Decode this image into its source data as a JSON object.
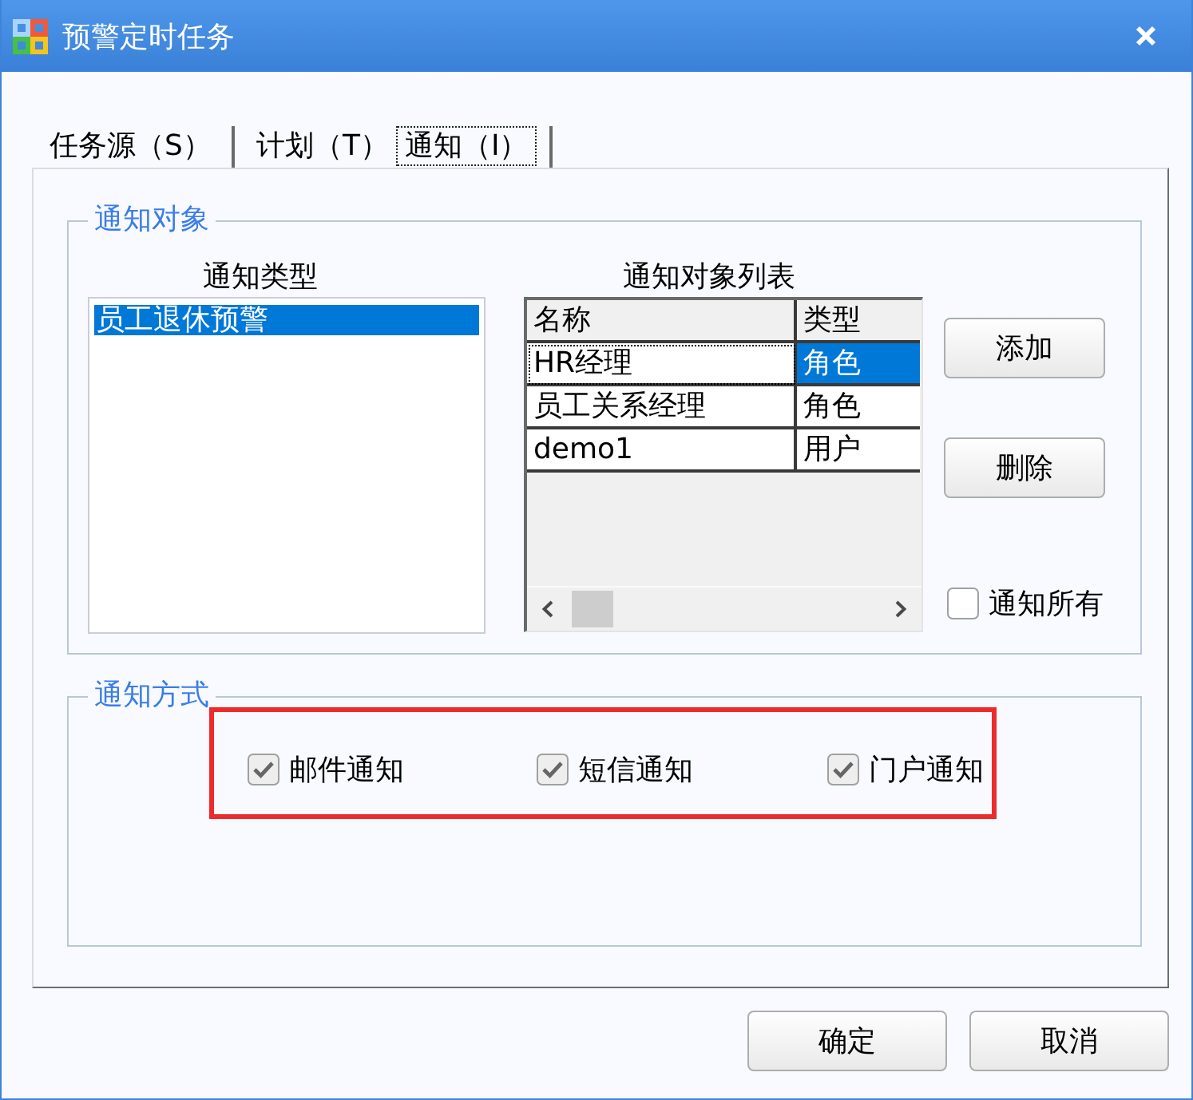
{
  "window": {
    "title": "预警定时任务"
  },
  "tabs": [
    {
      "label": "任务源（S）",
      "selected": false
    },
    {
      "label": "计划（T）",
      "selected": false
    },
    {
      "label": "通知（I）",
      "selected": true
    }
  ],
  "notify_targets": {
    "title": "通知对象",
    "type_list": {
      "label": "通知类型",
      "items": [
        {
          "text": "员工退休预警",
          "selected": true
        }
      ]
    },
    "target_table": {
      "label": "通知对象列表",
      "columns": [
        "名称",
        "类型"
      ],
      "rows": [
        {
          "cells": [
            "HR经理",
            "角色"
          ],
          "selected": true
        },
        {
          "cells": [
            "员工关系经理",
            "角色"
          ],
          "selected": false
        },
        {
          "cells": [
            "demo1",
            "用户"
          ],
          "selected": false
        }
      ]
    },
    "buttons": [
      "添加",
      "删除"
    ],
    "notify_all": {
      "label": "通知所有",
      "checked": false
    }
  },
  "notify_methods": {
    "title": "通知方式",
    "highlighted": true,
    "options": [
      {
        "label": "邮件通知",
        "checked": true
      },
      {
        "label": "短信通知",
        "checked": true
      },
      {
        "label": "门户通知",
        "checked": true
      }
    ]
  },
  "footer_buttons": [
    "确定",
    "取消"
  ]
}
